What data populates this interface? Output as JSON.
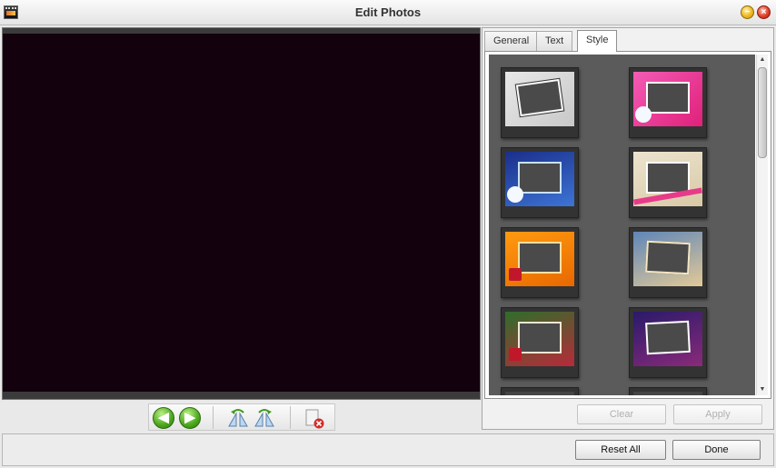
{
  "window": {
    "title": "Edit Photos",
    "minimize_glyph": "−",
    "close_glyph": "×"
  },
  "toolbar": {
    "previous_icon": "arrow-left-icon",
    "next_icon": "arrow-right-icon",
    "previous_glyph": "◀",
    "next_glyph": "▶",
    "flip_horizontal_icon": "flip-horizontal-icon",
    "flip_vertical_icon": "flip-vertical-icon",
    "delete_icon": "delete-photo-icon"
  },
  "side_panel": {
    "tabs": [
      {
        "label": "General",
        "active": false
      },
      {
        "label": "Text",
        "active": false
      },
      {
        "label": "Style",
        "active": true
      }
    ],
    "frames": [
      "plain-white-frame",
      "pink-teddy-frame",
      "blue-teddy-frame",
      "cream-ribbon-frame",
      "orange-gift-frame",
      "gold-vintage-frame",
      "green-holiday-frame",
      "purple-night-frame"
    ],
    "clear_label": "Clear",
    "apply_label": "Apply",
    "scroll_up_glyph": "▲",
    "scroll_down_glyph": "▼"
  },
  "footer": {
    "reset_label": "Reset All",
    "done_label": "Done"
  },
  "colors": {
    "canvas_background": "#13010d",
    "frames_background": "#5b5b5b",
    "nav_arrow_green": "#4aa71a"
  }
}
